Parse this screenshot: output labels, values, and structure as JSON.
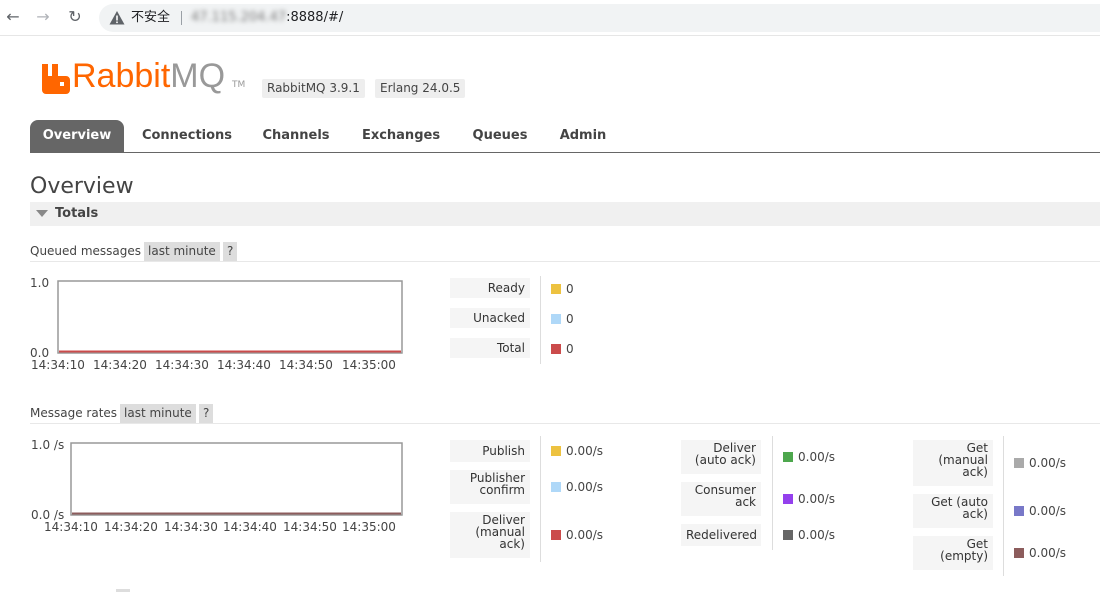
{
  "browser": {
    "insecure_label": "不安全",
    "url_host_masked": "47.115.204.47",
    "url_rest": ":8888/#/"
  },
  "header": {
    "logo_rabbit": "Rabbit",
    "logo_mq": "MQ",
    "logo_tm": "TM",
    "rabbitmq_version": "RabbitMQ 3.9.1",
    "erlang_version": "Erlang 24.0.5"
  },
  "tabs": [
    {
      "label": "Overview",
      "active": true
    },
    {
      "label": "Connections",
      "active": false
    },
    {
      "label": "Channels",
      "active": false
    },
    {
      "label": "Exchanges",
      "active": false
    },
    {
      "label": "Queues",
      "active": false
    },
    {
      "label": "Admin",
      "active": false
    }
  ],
  "page_title": "Overview",
  "totals": {
    "title": "Totals",
    "queued": {
      "label": "Queued messages",
      "range": "last minute",
      "help": "?",
      "y_max": "1.0",
      "y_min": "0.0",
      "x_ticks": [
        "14:34:10",
        "14:34:20",
        "14:34:30",
        "14:34:40",
        "14:34:50",
        "14:35:00"
      ],
      "legend": [
        {
          "name": "Ready",
          "value": "0",
          "color": "#edc240"
        },
        {
          "name": "Unacked",
          "value": "0",
          "color": "#afd8f8"
        },
        {
          "name": "Total",
          "value": "0",
          "color": "#cb4b4b"
        }
      ]
    },
    "rates": {
      "label": "Message rates",
      "range": "last minute",
      "help": "?",
      "y_max": "1.0 /s",
      "y_min": "0.0 /s",
      "x_ticks": [
        "14:34:10",
        "14:34:20",
        "14:34:30",
        "14:34:40",
        "14:34:50",
        "14:35:00"
      ],
      "col1": [
        {
          "name": "Publish",
          "value": "0.00/s",
          "color": "#edc240"
        },
        {
          "name": "Publisher confirm",
          "value": "0.00/s",
          "color": "#afd8f8"
        },
        {
          "name": "Deliver (manual ack)",
          "value": "0.00/s",
          "color": "#cb4b4b"
        }
      ],
      "col2": [
        {
          "name": "Deliver (auto ack)",
          "value": "0.00/s",
          "color": "#4da74d"
        },
        {
          "name": "Consumer ack",
          "value": "0.00/s",
          "color": "#9440ed"
        },
        {
          "name": "Redelivered",
          "value": "0.00/s",
          "color": "#666666"
        }
      ],
      "col3": [
        {
          "name": "Get (manual ack)",
          "value": "0.00/s",
          "color": "#aaaaaa"
        },
        {
          "name": "Get (auto ack)",
          "value": "0.00/s",
          "color": "#7878c8"
        },
        {
          "name": "Get (empty)",
          "value": "0.00/s",
          "color": "#8c5c5c"
        }
      ]
    }
  }
}
